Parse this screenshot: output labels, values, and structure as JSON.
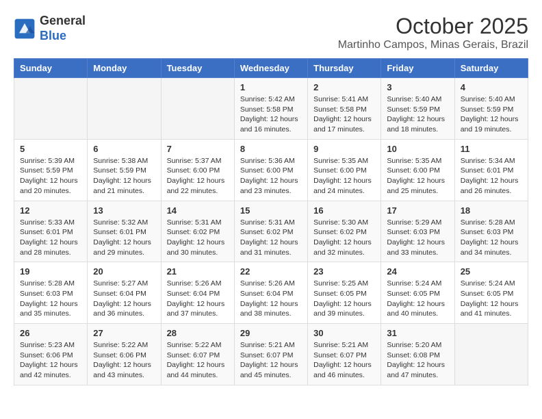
{
  "header": {
    "logo_line1": "General",
    "logo_line2": "Blue",
    "month_title": "October 2025",
    "subtitle": "Martinho Campos, Minas Gerais, Brazil"
  },
  "days_of_week": [
    "Sunday",
    "Monday",
    "Tuesday",
    "Wednesday",
    "Thursday",
    "Friday",
    "Saturday"
  ],
  "weeks": [
    [
      {
        "day": "",
        "info": ""
      },
      {
        "day": "",
        "info": ""
      },
      {
        "day": "",
        "info": ""
      },
      {
        "day": "1",
        "info": "Sunrise: 5:42 AM\nSunset: 5:58 PM\nDaylight: 12 hours and 16 minutes."
      },
      {
        "day": "2",
        "info": "Sunrise: 5:41 AM\nSunset: 5:58 PM\nDaylight: 12 hours and 17 minutes."
      },
      {
        "day": "3",
        "info": "Sunrise: 5:40 AM\nSunset: 5:59 PM\nDaylight: 12 hours and 18 minutes."
      },
      {
        "day": "4",
        "info": "Sunrise: 5:40 AM\nSunset: 5:59 PM\nDaylight: 12 hours and 19 minutes."
      }
    ],
    [
      {
        "day": "5",
        "info": "Sunrise: 5:39 AM\nSunset: 5:59 PM\nDaylight: 12 hours and 20 minutes."
      },
      {
        "day": "6",
        "info": "Sunrise: 5:38 AM\nSunset: 5:59 PM\nDaylight: 12 hours and 21 minutes."
      },
      {
        "day": "7",
        "info": "Sunrise: 5:37 AM\nSunset: 6:00 PM\nDaylight: 12 hours and 22 minutes."
      },
      {
        "day": "8",
        "info": "Sunrise: 5:36 AM\nSunset: 6:00 PM\nDaylight: 12 hours and 23 minutes."
      },
      {
        "day": "9",
        "info": "Sunrise: 5:35 AM\nSunset: 6:00 PM\nDaylight: 12 hours and 24 minutes."
      },
      {
        "day": "10",
        "info": "Sunrise: 5:35 AM\nSunset: 6:00 PM\nDaylight: 12 hours and 25 minutes."
      },
      {
        "day": "11",
        "info": "Sunrise: 5:34 AM\nSunset: 6:01 PM\nDaylight: 12 hours and 26 minutes."
      }
    ],
    [
      {
        "day": "12",
        "info": "Sunrise: 5:33 AM\nSunset: 6:01 PM\nDaylight: 12 hours and 28 minutes."
      },
      {
        "day": "13",
        "info": "Sunrise: 5:32 AM\nSunset: 6:01 PM\nDaylight: 12 hours and 29 minutes."
      },
      {
        "day": "14",
        "info": "Sunrise: 5:31 AM\nSunset: 6:02 PM\nDaylight: 12 hours and 30 minutes."
      },
      {
        "day": "15",
        "info": "Sunrise: 5:31 AM\nSunset: 6:02 PM\nDaylight: 12 hours and 31 minutes."
      },
      {
        "day": "16",
        "info": "Sunrise: 5:30 AM\nSunset: 6:02 PM\nDaylight: 12 hours and 32 minutes."
      },
      {
        "day": "17",
        "info": "Sunrise: 5:29 AM\nSunset: 6:03 PM\nDaylight: 12 hours and 33 minutes."
      },
      {
        "day": "18",
        "info": "Sunrise: 5:28 AM\nSunset: 6:03 PM\nDaylight: 12 hours and 34 minutes."
      }
    ],
    [
      {
        "day": "19",
        "info": "Sunrise: 5:28 AM\nSunset: 6:03 PM\nDaylight: 12 hours and 35 minutes."
      },
      {
        "day": "20",
        "info": "Sunrise: 5:27 AM\nSunset: 6:04 PM\nDaylight: 12 hours and 36 minutes."
      },
      {
        "day": "21",
        "info": "Sunrise: 5:26 AM\nSunset: 6:04 PM\nDaylight: 12 hours and 37 minutes."
      },
      {
        "day": "22",
        "info": "Sunrise: 5:26 AM\nSunset: 6:04 PM\nDaylight: 12 hours and 38 minutes."
      },
      {
        "day": "23",
        "info": "Sunrise: 5:25 AM\nSunset: 6:05 PM\nDaylight: 12 hours and 39 minutes."
      },
      {
        "day": "24",
        "info": "Sunrise: 5:24 AM\nSunset: 6:05 PM\nDaylight: 12 hours and 40 minutes."
      },
      {
        "day": "25",
        "info": "Sunrise: 5:24 AM\nSunset: 6:05 PM\nDaylight: 12 hours and 41 minutes."
      }
    ],
    [
      {
        "day": "26",
        "info": "Sunrise: 5:23 AM\nSunset: 6:06 PM\nDaylight: 12 hours and 42 minutes."
      },
      {
        "day": "27",
        "info": "Sunrise: 5:22 AM\nSunset: 6:06 PM\nDaylight: 12 hours and 43 minutes."
      },
      {
        "day": "28",
        "info": "Sunrise: 5:22 AM\nSunset: 6:07 PM\nDaylight: 12 hours and 44 minutes."
      },
      {
        "day": "29",
        "info": "Sunrise: 5:21 AM\nSunset: 6:07 PM\nDaylight: 12 hours and 45 minutes."
      },
      {
        "day": "30",
        "info": "Sunrise: 5:21 AM\nSunset: 6:07 PM\nDaylight: 12 hours and 46 minutes."
      },
      {
        "day": "31",
        "info": "Sunrise: 5:20 AM\nSunset: 6:08 PM\nDaylight: 12 hours and 47 minutes."
      },
      {
        "day": "",
        "info": ""
      }
    ]
  ]
}
